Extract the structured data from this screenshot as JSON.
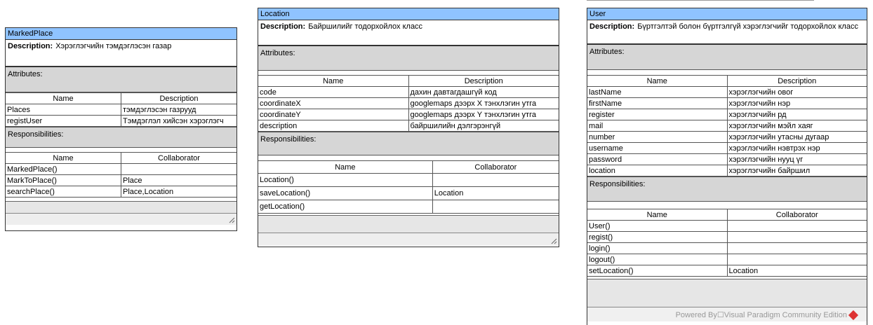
{
  "cards": {
    "marked_place": {
      "title": "MarkedPlace",
      "description_label": "Description:",
      "description": "Хэрэглэгчийн тэмдэглэсэн газар",
      "attributes_label": "Attributes:",
      "attr_headers": [
        "Name",
        "Description"
      ],
      "attributes": [
        [
          "Places",
          "тэмдэглэсэн газрууд"
        ],
        [
          "registUser",
          "Тэмдэглэл хийсэн хэрэглэгч"
        ]
      ],
      "responsibilities_label": "Responsibilities:",
      "resp_headers": [
        "Name",
        "Collaborator"
      ],
      "responsibilities": [
        [
          "MarkedPlace()",
          ""
        ],
        [
          "MarkToPlace()",
          "Place"
        ],
        [
          "searchPlace()",
          "Place,Location"
        ]
      ]
    },
    "location": {
      "title": "Location",
      "description_label": "Description:",
      "description": "Байршилийг тодорхойлох класс",
      "attributes_label": "Attributes:",
      "attr_headers": [
        "Name",
        "Description"
      ],
      "attributes": [
        [
          "code",
          "дахин давтагдашгүй код"
        ],
        [
          "coordinateX",
          "googlemaps дээрх X тэнхлэгин утга"
        ],
        [
          "coordinateY",
          "googlemaps дээрх Y тэнхлэгин утга"
        ],
        [
          "description",
          "байршилийн дэлгэрэнгүй"
        ]
      ],
      "responsibilities_label": "Responsibilities:",
      "resp_headers": [
        "Name",
        "Collaborator"
      ],
      "responsibilities": [
        [
          "Location()",
          ""
        ],
        [
          "saveLocation()",
          "Location"
        ],
        [
          "getLocation()",
          ""
        ]
      ]
    },
    "user": {
      "title": "User",
      "description_label": "Description:",
      "description": "Бүртгэлтэй болон бүртгэлгүй хэрэглэгчийг тодорхойлох класс",
      "attributes_label": "Attributes:",
      "attr_headers": [
        "Name",
        "Description"
      ],
      "attributes": [
        [
          "lastName",
          "хэрэглэгчийн овог"
        ],
        [
          "firstName",
          "хэрэглэгчийн нэр"
        ],
        [
          "register",
          "хэрэглэгчийн рд"
        ],
        [
          "mail",
          "хэрэглэгчийн мэйл хаяг"
        ],
        [
          "number",
          "хэрэглэгчийн утасны дугаар"
        ],
        [
          "username",
          "хэрэглэгчийн нэвтрэх нэр"
        ],
        [
          "password",
          "хэрэглэгчийн нууц үг"
        ],
        [
          "location",
          "хэрэглэгчийн байршил"
        ]
      ],
      "responsibilities_label": "Responsibilities:",
      "resp_headers": [
        "Name",
        "Collaborator"
      ],
      "responsibilities": [
        [
          "User()",
          ""
        ],
        [
          "regist()",
          ""
        ],
        [
          "login()",
          ""
        ],
        [
          "logout()",
          ""
        ],
        [
          "setLocation()",
          "Location"
        ]
      ]
    }
  },
  "footer": {
    "powered_text": "Powered By☐Visual Paradigm Community Edition"
  }
}
